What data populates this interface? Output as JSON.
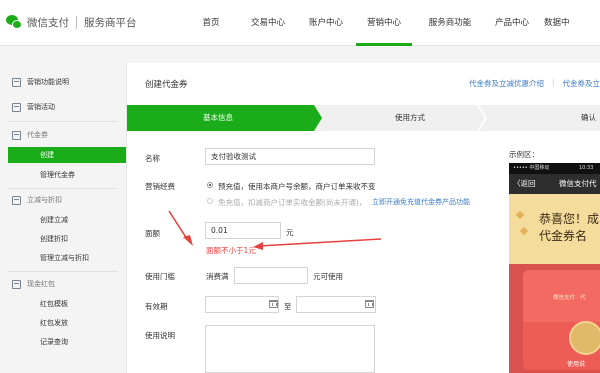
{
  "brand": {
    "name": "微信支付",
    "sub": "服务商平台"
  },
  "nav": [
    "首页",
    "交易中心",
    "账户中心",
    "营销中心",
    "服务商功能",
    "产品中心",
    "数据中"
  ],
  "nav_active": "营销中心",
  "sidebar": {
    "top": [
      "营销功能说明",
      "营销活动"
    ],
    "groups": [
      {
        "title": "代金券",
        "items": [
          "创建",
          "管理代金券"
        ]
      },
      {
        "title": "立减与折扣",
        "items": [
          "创建立减",
          "创建折扣",
          "管理立减与折扣"
        ]
      },
      {
        "title": "现金红包",
        "items": [
          "红包模板",
          "红包发放",
          "记录查询"
        ]
      }
    ],
    "active_item": "创建"
  },
  "page": {
    "title": "创建代金券",
    "links": [
      "代金券及立减优惠介绍",
      "代金券及立"
    ]
  },
  "steps": [
    "基本信息",
    "使用方式",
    "确认"
  ],
  "form": {
    "name_label": "名称",
    "name_value": "支付验收测试",
    "funding_label": "营销经费",
    "funding_option1": "预充值，使用本商户号余额，商户订单来收不变",
    "funding_option2": "免充值，扣减商户订单实收金额(尚未开通)，",
    "funding_option2_link": "立即开通免充值代金券产品功能",
    "amount_label": "面额",
    "amount_value": "0.01",
    "amount_unit": "元",
    "amount_error": "面额不小于1元",
    "threshold_label": "使用门槛",
    "threshold_prefix": "消费满",
    "threshold_suffix": "元可使用",
    "validity_label": "有效期",
    "validity_to": "至",
    "desc_label": "使用说明"
  },
  "preview": {
    "label": "示例区：",
    "status_left": "••••• 中国移动",
    "status_right": "10:33",
    "back": "〈返回",
    "title": "微信支付代",
    "congrats": "恭喜您！成",
    "subtitle": "代金券名",
    "envelope_text": "微信支付 · 代",
    "use_text": "使用说"
  },
  "colors": {
    "accent": "#1aad19",
    "link": "#3a7bc8",
    "error": "#e64340"
  }
}
